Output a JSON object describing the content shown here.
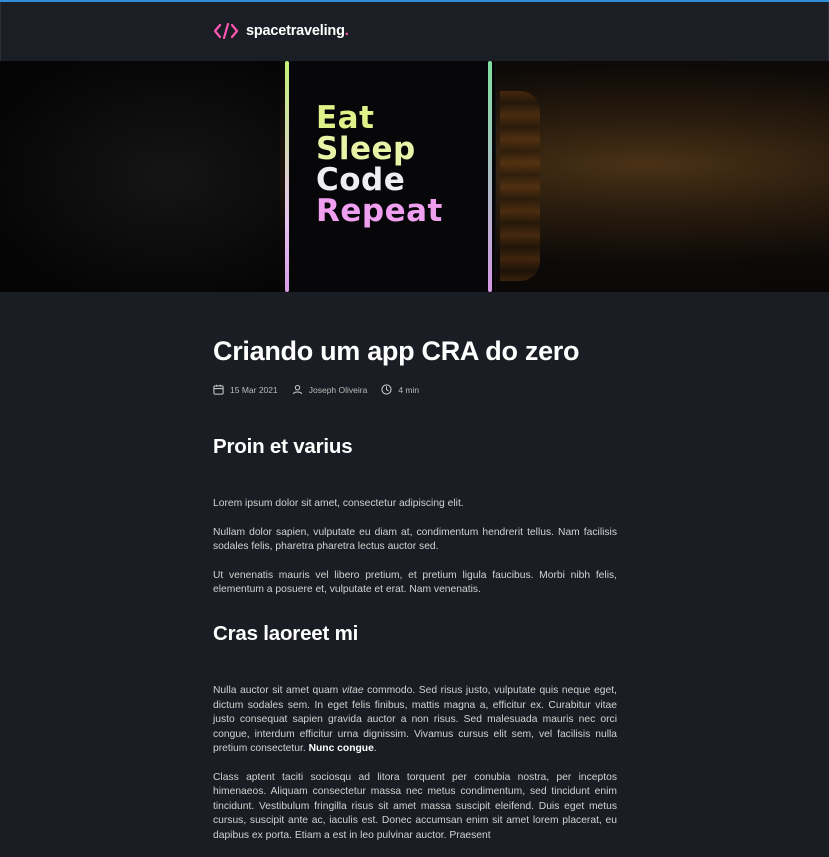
{
  "header": {
    "logo_text": "spacetraveling",
    "logo_dot": ".",
    "accent_color": "#ff57b2"
  },
  "banner": {
    "image_text": [
      "Eat",
      "Sleep",
      "Code",
      "Repeat"
    ]
  },
  "post": {
    "title": "Criando um app CRA do zero",
    "date": "15 Mar 2021",
    "author": "Joseph Oliveira",
    "reading_time": "4 min",
    "icons": [
      "calendar-icon",
      "user-icon",
      "clock-icon"
    ]
  },
  "sections": [
    {
      "heading": "Proin et varius",
      "paragraphs": [
        "Lorem ipsum dolor sit amet, consectetur adipiscing elit.",
        "Nullam dolor sapien, vulputate eu diam at, condimentum hendrerit tellus. Nam facilisis sodales felis, pharetra pharetra lectus auctor sed.",
        "Ut venenatis mauris vel libero pretium, et pretium ligula faucibus. Morbi nibh felis, elementum a posuere et, vulputate et erat. Nam venenatis."
      ]
    },
    {
      "heading": "Cras laoreet mi",
      "p1_a": "Nulla auctor sit amet quam ",
      "p1_em": "vitae",
      "p1_b": " commodo. Sed risus justo, vulputate quis neque eget, dictum sodales sem. In eget felis finibus, mattis magna a, efficitur ex. Curabitur vitae justo consequat sapien gravida auctor a non risus. Sed malesuada mauris nec orci congue, interdum efficitur urna dignissim. Vivamus cursus elit sem, vel facilisis nulla pretium consectetur. ",
      "p1_strong": "Nunc congue",
      "p1_c": ".",
      "p2": "Class aptent taciti sociosqu ad litora torquent per conubia nostra, per inceptos himenaeos. Aliquam consectetur massa nec metus condimentum, sed tincidunt enim tincidunt. Vestibulum fringilla risus sit amet massa suscipit eleifend. Duis eget metus cursus, suscipit ante ac, iaculis est. Donec accumsan enim sit amet lorem placerat, eu dapibus ex porta. Etiam a est in leo pulvinar auctor. Praesent"
    }
  ]
}
